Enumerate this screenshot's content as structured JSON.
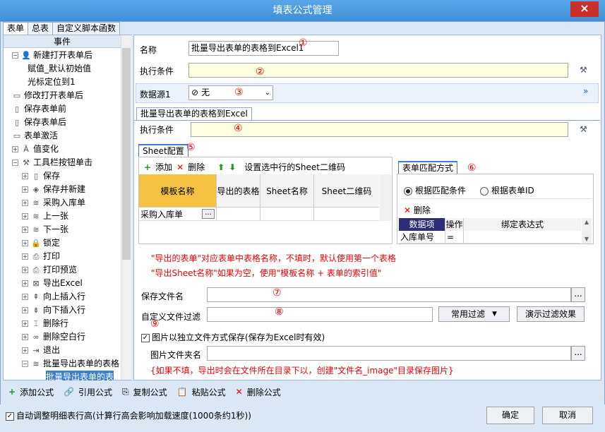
{
  "window": {
    "title": "填表公式管理",
    "close": "×"
  },
  "tabs": [
    "表单",
    "总表",
    "自定义脚本函数"
  ],
  "left": {
    "header": "事件",
    "tree": [
      {
        "label": "新建打开表单后",
        "level": 0,
        "toggle": "−",
        "icon": "user-icon",
        "glyph": "👤"
      },
      {
        "label": "赋值_默认初始值",
        "level": 2,
        "toggle": "",
        "icon": "",
        "glyph": ""
      },
      {
        "label": "光标定位到1",
        "level": 2,
        "toggle": "",
        "icon": "",
        "glyph": ""
      },
      {
        "label": "修改打开表单后",
        "level": 0,
        "toggle": "",
        "icon": "folder-icon",
        "glyph": "▭"
      },
      {
        "label": "保存表单前",
        "level": 0,
        "toggle": "",
        "icon": "doc-icon",
        "glyph": "▯"
      },
      {
        "label": "保存表单后",
        "level": 0,
        "toggle": "",
        "icon": "doc-icon",
        "glyph": "▯"
      },
      {
        "label": "表单激活",
        "level": 0,
        "toggle": "",
        "icon": "folder-icon",
        "glyph": "▭"
      },
      {
        "label": "值变化",
        "level": 0,
        "toggle": "+",
        "icon": "value-icon",
        "glyph": "Ā"
      },
      {
        "label": "工具栏按钮单击",
        "level": 0,
        "toggle": "−",
        "icon": "tools-icon",
        "glyph": "⚒"
      },
      {
        "label": "保存",
        "level": 1,
        "toggle": "+",
        "icon": "save-icon",
        "glyph": "▯"
      },
      {
        "label": "保存并新建",
        "level": 1,
        "toggle": "+",
        "icon": "shield-icon",
        "glyph": "◈"
      },
      {
        "label": "采购入库单",
        "level": 1,
        "toggle": "+",
        "icon": "layers-icon",
        "glyph": "≋"
      },
      {
        "label": "上一张",
        "level": 1,
        "toggle": "+",
        "icon": "layers-icon",
        "glyph": "≋"
      },
      {
        "label": "下一张",
        "level": 1,
        "toggle": "+",
        "icon": "layers-icon",
        "glyph": "≋"
      },
      {
        "label": "锁定",
        "level": 1,
        "toggle": "+",
        "icon": "lock-icon",
        "glyph": "🔒"
      },
      {
        "label": "打印",
        "level": 1,
        "toggle": "+",
        "icon": "print-icon",
        "glyph": "⎙"
      },
      {
        "label": "打印预览",
        "level": 1,
        "toggle": "+",
        "icon": "preview-icon",
        "glyph": "⎙"
      },
      {
        "label": "导出Excel",
        "level": 1,
        "toggle": "+",
        "icon": "excel-icon",
        "glyph": "⊠"
      },
      {
        "label": "向上插入行",
        "level": 1,
        "toggle": "+",
        "icon": "insert-up-icon",
        "glyph": "⇞"
      },
      {
        "label": "向下插入行",
        "level": 1,
        "toggle": "+",
        "icon": "insert-down-icon",
        "glyph": "⇟"
      },
      {
        "label": "删除行",
        "level": 1,
        "toggle": "+",
        "icon": "delete-row-icon",
        "glyph": "⌶"
      },
      {
        "label": "删除空白行",
        "level": 1,
        "toggle": "+",
        "icon": "delete-blank-icon",
        "glyph": "∞"
      },
      {
        "label": "退出",
        "level": 1,
        "toggle": "+",
        "icon": "exit-icon",
        "glyph": "⇥"
      },
      {
        "label": "批量导出表单的表格",
        "level": 1,
        "toggle": "−",
        "icon": "layers-icon",
        "glyph": "≋"
      },
      {
        "label": "批量导出表单的表",
        "level": 3,
        "toggle": "",
        "icon": "",
        "glyph": "",
        "selected": true
      }
    ]
  },
  "form": {
    "name_label": "名称",
    "name_value": "批量导出表单的表格到Excel1",
    "cond_label": "执行条件",
    "cond_value": "",
    "ds_label": "数据源1",
    "ds_value": "无",
    "section_tab": "批量导出表单的表格到Excel",
    "cond2_label": "执行条件",
    "cond2_value": "",
    "sheet_tab": "Sheet配置",
    "add": "添加",
    "delete": "删除",
    "set_qr": "设置选中行的Sheet二维码",
    "sheet_columns": [
      "模板名称",
      "导出的表格",
      "Sheet名称",
      "Sheet二维码"
    ],
    "sheet_rows": [
      [
        "采购入库单",
        "",
        "",
        ""
      ]
    ],
    "match_tab": "表单匹配方式",
    "radio1": "根据匹配条件",
    "radio2": "根据表单ID",
    "match_delete": "删除",
    "match_columns": [
      "数据项",
      "操作",
      "绑定表达式"
    ],
    "match_rows": [
      [
        "入库单号",
        "=",
        ""
      ]
    ],
    "note1": "\"导出的表单\"对应表单中表格名称，不填时，默认使用第一个表格",
    "note2": "\"导出Sheet名称\"如果为空，使用\"模板名称 + 表单的索引值\"",
    "savefile_label": "保存文件名",
    "savefile_value": "",
    "filter_label": "自定义文件过滤",
    "filter_value": "",
    "common_filter": "常用过滤",
    "demo_filter": "演示过滤效果",
    "img_check_label": "图片以独立文件方式保存(保存为Excel时有效)",
    "img_folder_label": "图片文件夹名",
    "img_folder_value": "",
    "img_note": "{如果不填，导出时会在文件所在目录下以，创建\"文件名_image\"目录保存图片}",
    "ellipsis": "...",
    "markers": [
      "①",
      "②",
      "③",
      "④",
      "⑤",
      "⑥",
      "⑦",
      "⑧",
      "⑨"
    ]
  },
  "bottom": {
    "add": "添加公式",
    "ref": "引用公式",
    "copy": "复制公式",
    "paste": "粘贴公式",
    "del": "删除公式"
  },
  "footer": {
    "auto_label": "自动调整明细表行高(计算行高会影响加载速度(1000条约1秒))",
    "ok": "确定",
    "cancel": "取消"
  }
}
